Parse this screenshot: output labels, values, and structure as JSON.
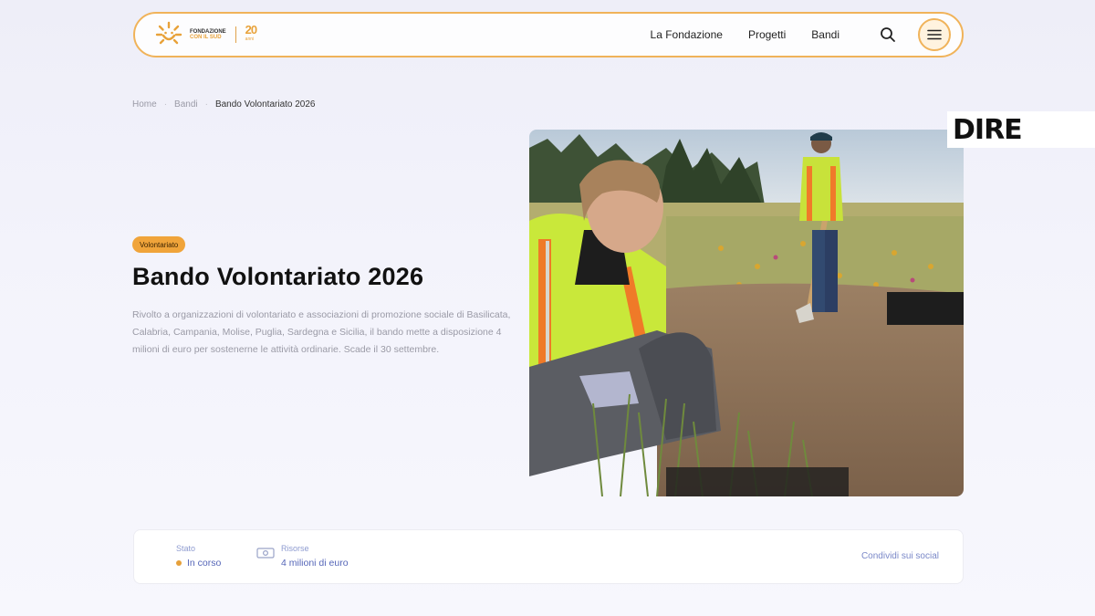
{
  "header": {
    "logo": {
      "name_line1": "FONDAZIONE",
      "name_line2": "CON IL SUD",
      "anniversary": "20",
      "anniversary_sub": "anni"
    },
    "nav": [
      {
        "label": "La Fondazione"
      },
      {
        "label": "Progetti"
      },
      {
        "label": "Bandi"
      }
    ],
    "icons": {
      "search": "search-icon",
      "menu": "hamburger-menu-icon"
    },
    "accent_color": "#f0b35a"
  },
  "breadcrumb": [
    "Home",
    "Bandi",
    "Bando Volontariato 2026"
  ],
  "hero": {
    "tag": "Volontariato",
    "title": "Bando Volontariato 2026",
    "description": "Rivolto a organizzazioni di volontariato e associazioni di promozione sociale di Basilicata, Calabria, Campania, Molise, Puglia, Sardegna e Sicilia, il bando mette a disposizione 4 milioni di euro per sostenerne le attività ordinarie. Scade il 30 settembre.",
    "tag_color": "#f0a43a"
  },
  "watermark": {
    "brand": "DIRE"
  },
  "info_bar": {
    "status_label": "Stato",
    "status_value": "In corso",
    "resources_label": "Risorse",
    "resources_value": "4 milioni di euro",
    "share_label": "Condividi sui social",
    "link_color": "#5566b8"
  }
}
